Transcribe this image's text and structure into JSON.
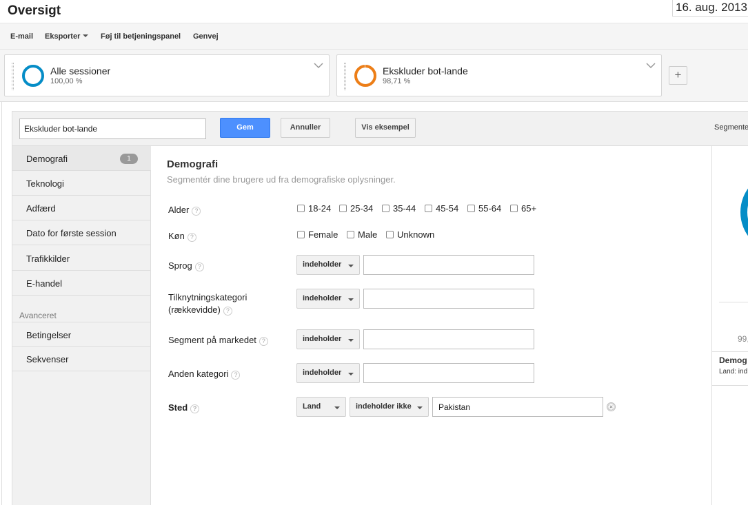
{
  "header": {
    "title": "Oversigt",
    "date_range": "16. aug. 2013"
  },
  "toolbar": {
    "email": "E-mail",
    "export": "Eksporter",
    "add_to_dashboard": "Føj til betjeningspanel",
    "shortcut": "Genvej"
  },
  "segments": [
    {
      "name": "Alle sessioner",
      "percent": "100,00 %",
      "color": "#058dc7",
      "share": 1.0
    },
    {
      "name": "Ekskluder bot-lande",
      "percent": "98,71 %",
      "color": "#ed7e17",
      "share": 0.9871
    }
  ],
  "editor": {
    "segment_name_value": "Ekskluder bot-lande",
    "save_label": "Gem",
    "cancel_label": "Annuller",
    "preview_label": "Vis eksempel",
    "segment_prop_label": "Segmentet"
  },
  "nav": {
    "items": [
      {
        "label": "Demografi",
        "badge": "1"
      },
      {
        "label": "Teknologi"
      },
      {
        "label": "Adfærd"
      },
      {
        "label": "Dato for første session"
      },
      {
        "label": "Trafikkilder"
      },
      {
        "label": "E-handel"
      }
    ],
    "advanced_heading": "Avanceret",
    "advanced_items": [
      {
        "label": "Betingelser"
      },
      {
        "label": "Sekvenser"
      }
    ]
  },
  "form": {
    "title": "Demografi",
    "subtitle": "Segmentér dine brugere ud fra demografiske oplysninger.",
    "help_glyph": "?",
    "age": {
      "label": "Alder",
      "options": [
        "18-24",
        "25-34",
        "35-44",
        "45-54",
        "55-64",
        "65+"
      ]
    },
    "gender": {
      "label": "Køn",
      "options": [
        "Female",
        "Male",
        "Unknown"
      ]
    },
    "language": {
      "label": "Sprog",
      "operator": "indeholder",
      "value": ""
    },
    "affinity": {
      "label_line1": "Tilknytningskategori",
      "label_line2": "(rækkevidde)",
      "operator": "indeholder",
      "value": ""
    },
    "in_market": {
      "label": "Segment på markedet",
      "operator": "indeholder",
      "value": ""
    },
    "other_category": {
      "label": "Anden kategori",
      "operator": "indeholder",
      "value": ""
    },
    "location": {
      "label": "Sted",
      "dimension": "Land",
      "operator": "indeholder ikke",
      "value": "Pakistan"
    }
  },
  "summary": {
    "percent_partial": "99,",
    "title_partial": "Demog",
    "text_partial": "Land: ind",
    "ring_color": "#058dc7"
  }
}
